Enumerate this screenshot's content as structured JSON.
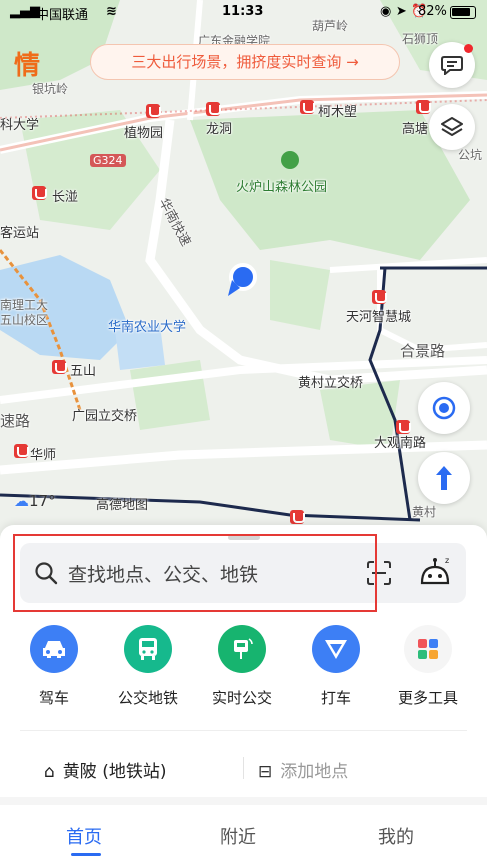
{
  "status_bar": {
    "carrier": "中国联通",
    "time": "11:33",
    "battery": "82%"
  },
  "banner": {
    "logo_text": "情",
    "text": "三大出行场景，拥挤度实时查询 →"
  },
  "map": {
    "labels": {
      "l1": "银坑岭",
      "l2": "广东金融学院",
      "l3": "葫芦岭",
      "l4": "石狮顶",
      "l5": "科大学",
      "l6": "植物园",
      "l7": "龙洞",
      "l8": "柯木塱",
      "l9": "高塘",
      "l10": "公坑",
      "l11": "G324",
      "l12": "火炉山森林公园",
      "l13": "长湴",
      "l14": "华南快速",
      "l15": "客运站",
      "l16": "天河智慧城",
      "l17": "南理工大",
      "l18": "五山校区",
      "l19": "华南农业大学",
      "l20": "合景路",
      "l21": "五山",
      "l22": "黄村立交桥",
      "l23": "速路",
      "l24": "广园立交桥",
      "l25": "大观南路",
      "l26": "华师",
      "l27": "黄村"
    },
    "weather_temp": "17°",
    "provider": "高德地图"
  },
  "search": {
    "placeholder": "查找地点、公交、地铁"
  },
  "tools": [
    {
      "label": "驾车",
      "icon": "car-icon",
      "color": "#3d7ff5"
    },
    {
      "label": "公交地铁",
      "icon": "bus-icon",
      "color": "#16b98d"
    },
    {
      "label": "实时公交",
      "icon": "realtime-bus-icon",
      "color": "#17b46f"
    },
    {
      "label": "打车",
      "icon": "taxi-icon",
      "color": "#3d7ff5"
    },
    {
      "label": "更多工具",
      "icon": "grid-apps-icon",
      "color": "#f5f5f5"
    }
  ],
  "places": {
    "home": "黄陂 (地铁站)",
    "add": "添加地点"
  },
  "bottom_nav": [
    {
      "label": "首页",
      "active": true
    },
    {
      "label": "附近",
      "active": false
    },
    {
      "label": "我的",
      "active": false
    }
  ],
  "colors": {
    "accent": "#2a6bf2",
    "banner_text": "#ef5b3c",
    "metro_red": "#e53935"
  }
}
